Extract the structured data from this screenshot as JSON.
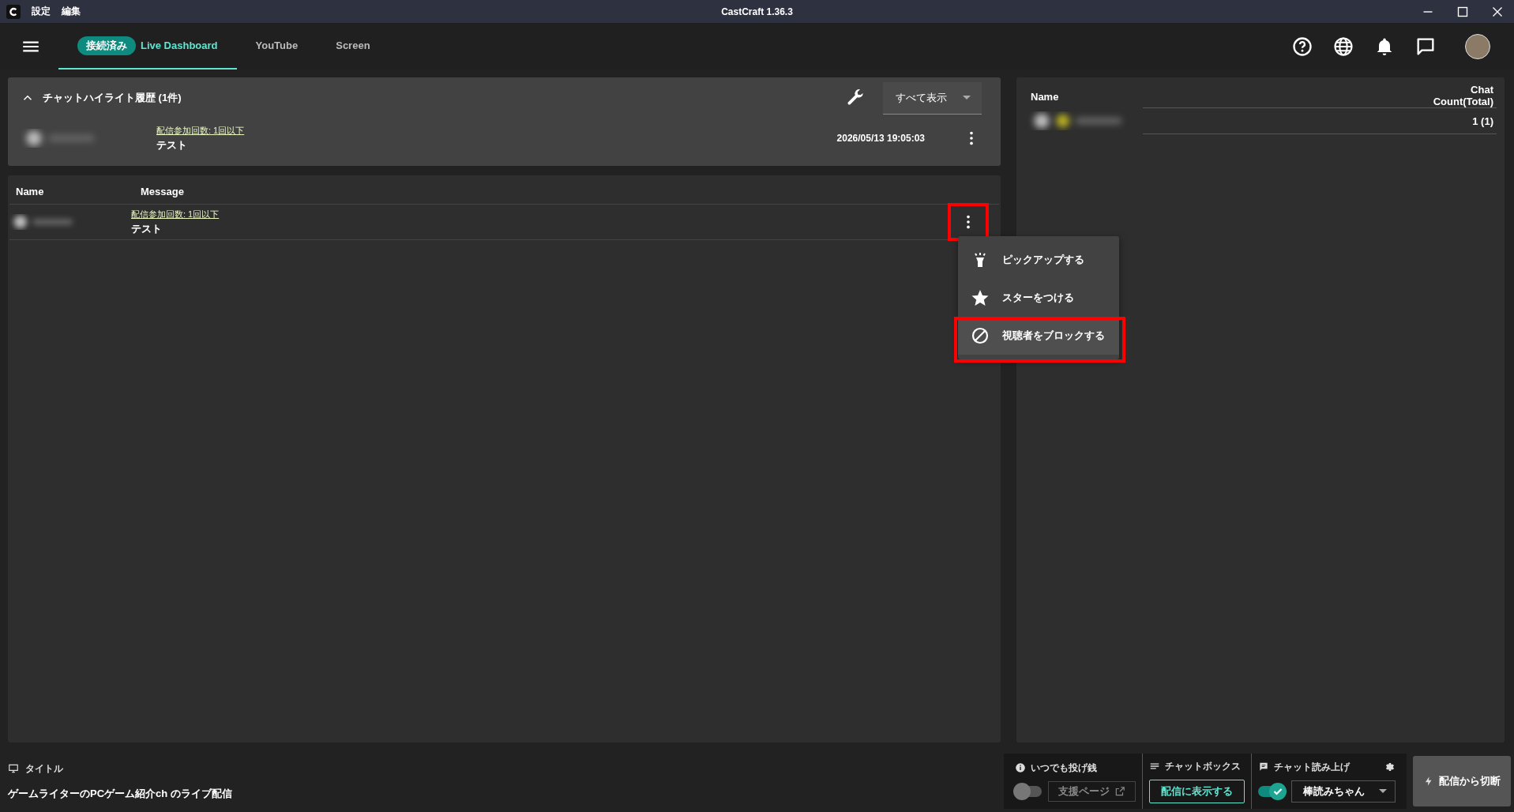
{
  "window": {
    "title": "CastCraft 1.36.3",
    "menu": [
      "設定",
      "編集"
    ]
  },
  "nav": {
    "status_badge": "接続済み",
    "tabs": [
      {
        "label": "Live Dashboard",
        "selected": true
      },
      {
        "label": "YouTube",
        "selected": false
      },
      {
        "label": "Screen",
        "selected": false
      }
    ]
  },
  "highlights": {
    "title": "チャットハイライト履歴 (1件)",
    "expanded": true,
    "filter": "すべて表示",
    "items": [
      {
        "tag": "配信参加回数: 1回以下",
        "message": "テスト",
        "time": "2026/05/13 19:05:03"
      }
    ]
  },
  "chat_table": {
    "columns": [
      "Name",
      "Message"
    ],
    "rows": [
      {
        "tag": "配信参加回数: 1回以下",
        "message": "テスト",
        "highlighted": true
      }
    ]
  },
  "context_menu": {
    "items": [
      {
        "kind": "pickup",
        "label": "ピックアップする",
        "selected": false,
        "highlighted": false
      },
      {
        "kind": "star",
        "label": "スターをつける",
        "selected": false,
        "highlighted": false
      },
      {
        "kind": "block",
        "label": "視聴者をブロックする",
        "selected": true,
        "highlighted": true
      }
    ]
  },
  "viewers": {
    "columns": [
      "Name",
      "Chat Count(Total)"
    ],
    "rows": [
      {
        "count": "1 (1)"
      }
    ]
  },
  "footer": {
    "title_label": "タイトル",
    "stream_title": "ゲームライターのPCゲーム紹介ch のライブ配信",
    "tipping": {
      "label": "いつでも投げ銭",
      "on": false,
      "button": "支援ページ"
    },
    "chatbox": {
      "label": "チャットボックス",
      "button": "配信に表示する"
    },
    "tts": {
      "label": "チャット読み上げ",
      "on": true,
      "voice": "棒読みちゃん"
    },
    "disconnect": "配信から切断"
  }
}
